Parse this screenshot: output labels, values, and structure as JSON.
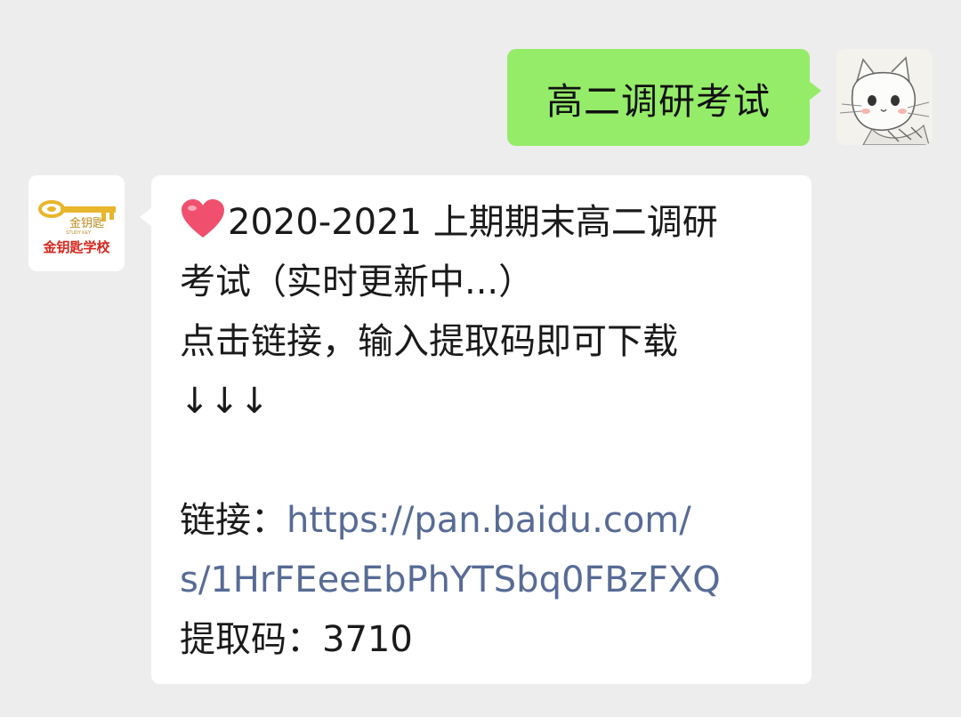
{
  "outgoing": {
    "text": "高二调研考试"
  },
  "incoming": {
    "line1": "2020-2021 上期期末高二调研",
    "line2": "考试（实时更新中...）",
    "line3": "点击链接，输入提取码即可下载",
    "line4": "↓↓↓",
    "link_label": "链接：",
    "link_part1": "https://pan.baidu.com/",
    "link_part2": "s/1HrFEeeEbPhYTSbq0FBzFXQ",
    "code_label": "提取码：",
    "code_value": "3710"
  },
  "avatars": {
    "school_text": "金钥匙学校",
    "school_sub": "STUDY KEY",
    "school_logo_cn": "金钥匙"
  },
  "colors": {
    "background": "#ededed",
    "outgoing_bubble": "#95ec69",
    "incoming_bubble": "#ffffff",
    "link": "#576b95",
    "heart": "#f0506e",
    "logo_red": "#d9261c",
    "logo_gold": "#e8b62c"
  },
  "icons": [
    "heart-icon",
    "cat-avatar-icon",
    "golden-key-logo-icon"
  ]
}
